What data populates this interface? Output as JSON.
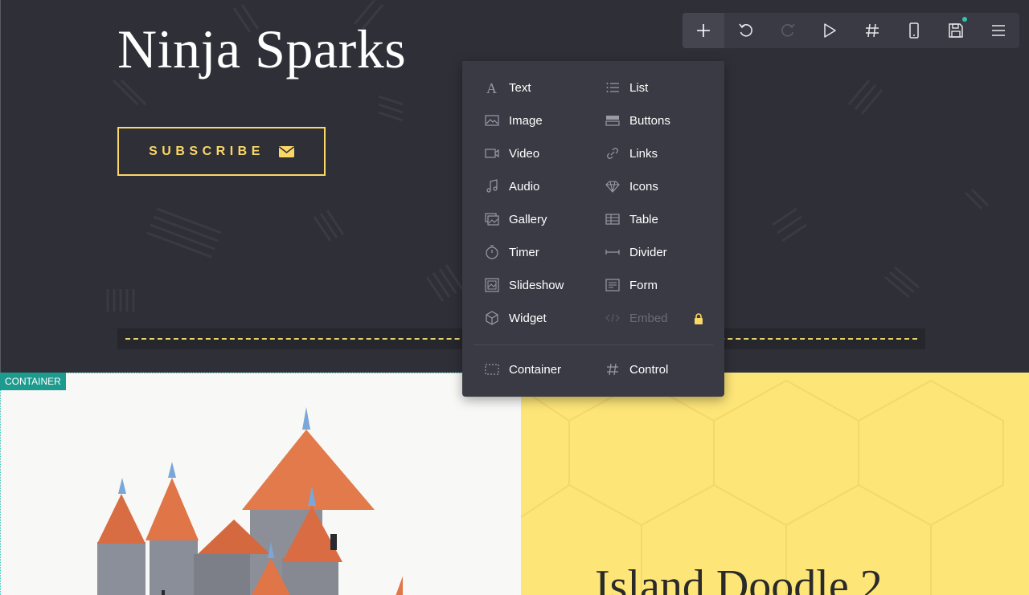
{
  "hero": {
    "title": "Ninja Sparks",
    "subscribe_label": "SUBSCRIBE",
    "accent_color": "#fbd766"
  },
  "toolbar": {
    "items": [
      {
        "name": "add",
        "icon": "plus-icon"
      },
      {
        "name": "undo",
        "icon": "undo-icon"
      },
      {
        "name": "redo",
        "icon": "redo-icon"
      },
      {
        "name": "preview",
        "icon": "play-icon"
      },
      {
        "name": "grid",
        "icon": "hash-icon"
      },
      {
        "name": "mobile",
        "icon": "mobile-icon"
      },
      {
        "name": "save",
        "icon": "save-icon"
      },
      {
        "name": "menu",
        "icon": "hamburger-icon"
      }
    ]
  },
  "add_menu": {
    "left_column": [
      {
        "label": "Text",
        "icon": "text-icon"
      },
      {
        "label": "Image",
        "icon": "image-icon"
      },
      {
        "label": "Video",
        "icon": "video-icon"
      },
      {
        "label": "Audio",
        "icon": "audio-icon"
      },
      {
        "label": "Gallery",
        "icon": "gallery-icon"
      },
      {
        "label": "Timer",
        "icon": "timer-icon"
      },
      {
        "label": "Slideshow",
        "icon": "slideshow-icon"
      },
      {
        "label": "Widget",
        "icon": "widget-icon"
      }
    ],
    "right_column": [
      {
        "label": "List",
        "icon": "list-icon"
      },
      {
        "label": "Buttons",
        "icon": "buttons-icon"
      },
      {
        "label": "Links",
        "icon": "link-icon"
      },
      {
        "label": "Icons",
        "icon": "diamond-icon"
      },
      {
        "label": "Table",
        "icon": "table-icon"
      },
      {
        "label": "Divider",
        "icon": "divider-icon"
      },
      {
        "label": "Form",
        "icon": "form-icon"
      },
      {
        "label": "Embed",
        "icon": "code-icon",
        "locked": true
      }
    ],
    "footer": [
      {
        "label": "Container",
        "icon": "container-icon"
      },
      {
        "label": "Control",
        "icon": "hash-icon"
      }
    ]
  },
  "container_badge": "CONTAINER",
  "lower": {
    "right_title": "Island Doodle 2",
    "right_bg": "#fde578",
    "container_color": "#1e9b8f"
  }
}
